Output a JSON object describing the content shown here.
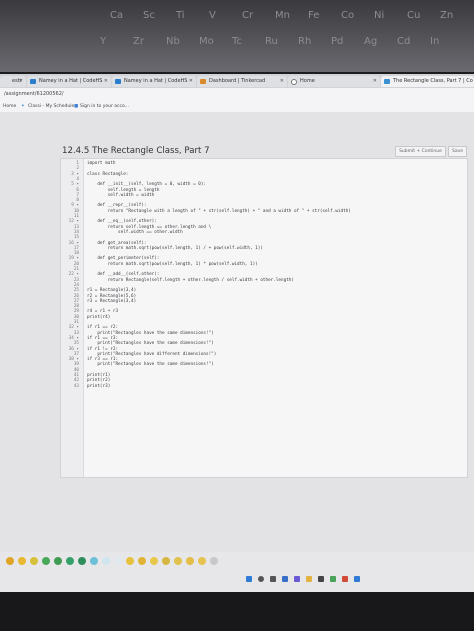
{
  "poster_cells": [
    "Ca",
    "Sc",
    "Ti",
    "V",
    "Cr",
    "Mn",
    "Fe",
    "Co",
    "Ni",
    "Cu",
    "Zn",
    "Y",
    "Zr",
    "Nb",
    "Mo",
    "Tc",
    "Ru",
    "Rh",
    "Pd",
    "Ag",
    "Cd",
    "In"
  ],
  "tabs": [
    {
      "label": "estr"
    },
    {
      "label": "Namey in a Hat | CodeHS"
    },
    {
      "label": "Namey in a Hat | CodeHS"
    },
    {
      "label": "Dashboard | Tinkercad"
    },
    {
      "label": "Home"
    },
    {
      "label": "The Rectangle Class, Part 7 | Co"
    }
  ],
  "address": {
    "url": "/assignment/61200562/"
  },
  "bookmarks": [
    "Home",
    "Classi - My Schedule",
    "Sign in to your acco..."
  ],
  "page": {
    "title": "12.4.5 The Rectangle Class, Part 7",
    "submit_label": "Submit + Continue",
    "save_label": "Save"
  },
  "code_lines": [
    {
      "n": "1",
      "text": "import math"
    },
    {
      "n": "2",
      "text": ""
    },
    {
      "n": "3 ▾",
      "text": "class Rectangle:"
    },
    {
      "n": "4",
      "text": ""
    },
    {
      "n": "5 ▾",
      "text": "    def __init__(self, length = 0, width = 0):"
    },
    {
      "n": "6",
      "text": "        self.length = length"
    },
    {
      "n": "7",
      "text": "        self.width = width"
    },
    {
      "n": "8",
      "text": ""
    },
    {
      "n": "9 ▾",
      "text": "    def __repr__(self):"
    },
    {
      "n": "10",
      "text": "        return \"Rectangle with a length of \" + str(self.length) + \" and a width of \" + str(self.width)"
    },
    {
      "n": "11",
      "text": ""
    },
    {
      "n": "12 ▾",
      "text": "    def __eq__(self,other):"
    },
    {
      "n": "13",
      "text": "        return self.length == other.length and \\"
    },
    {
      "n": "14",
      "text": "            self.width == other.width"
    },
    {
      "n": "15",
      "text": ""
    },
    {
      "n": "16 ▾",
      "text": "    def get_area(self):"
    },
    {
      "n": "17",
      "text": "        return math.sqrt(pow(self.length, 1) / + pow(self.width, 1))"
    },
    {
      "n": "18",
      "text": ""
    },
    {
      "n": "19 ▾",
      "text": "    def get_perimeter(self):"
    },
    {
      "n": "20",
      "text": "        return math.sqrt(pow(self.length, 1) * pow(self.width, 1))"
    },
    {
      "n": "21",
      "text": ""
    },
    {
      "n": "22 ▾",
      "text": "    def __add__(self,other):"
    },
    {
      "n": "23",
      "text": "        return Rectangle(self.length + other.length / self.width + other.length)"
    },
    {
      "n": "24",
      "text": ""
    },
    {
      "n": "25",
      "text": "r1 = Rectangle(3,4)"
    },
    {
      "n": "26",
      "text": "r2 = Rectangle(5,6)"
    },
    {
      "n": "27",
      "text": "r3 = Rectangle(3,4)"
    },
    {
      "n": "28",
      "text": ""
    },
    {
      "n": "29",
      "text": "r4 = r1 + r3"
    },
    {
      "n": "30",
      "text": "print(r4)"
    },
    {
      "n": "31",
      "text": ""
    },
    {
      "n": "32 ▾",
      "text": "if r1 == r2:"
    },
    {
      "n": "33",
      "text": "    print(\"Rectangles have the same dimensions!\")"
    },
    {
      "n": "34 ▾",
      "text": "if r1 == r3:"
    },
    {
      "n": "35",
      "text": "    print(\"Rectangles have the same dimensions!\")"
    },
    {
      "n": "36 ▾",
      "text": "if r1 != r2:"
    },
    {
      "n": "37",
      "text": "    print(\"Rectangles have different dimensions!\")"
    },
    {
      "n": "38 ▾",
      "text": "if r3 == r1:"
    },
    {
      "n": "39",
      "text": "    print(\"Rectangles have the same dimensions!\")"
    },
    {
      "n": "40",
      "text": ""
    },
    {
      "n": "41",
      "text": "print(r1)"
    },
    {
      "n": "42",
      "text": "print(r2)"
    },
    {
      "n": "43",
      "text": "print(r3)"
    }
  ],
  "bottom_circle_colors": [
    "#e0a526",
    "#e8b830",
    "#d6c23a",
    "#47a85a",
    "#3f9c52",
    "#36a06b",
    "#2e8f5c",
    "#6cc0d8",
    "#cfe6ee",
    "#dfe9ee",
    "#e6c13d",
    "#e2b436",
    "#e8c84a",
    "#d6b642",
    "#e0c24c",
    "#e3bd45",
    "#e6c34f",
    "#c7c7cc"
  ],
  "taskbar_icons": [
    "windows-start-icon",
    "search-icon",
    "task-view-icon",
    "widgets-icon",
    "chat-icon",
    "file-explorer-icon",
    "store-icon",
    "chrome-icon",
    "office-icon",
    "mail-icon"
  ]
}
